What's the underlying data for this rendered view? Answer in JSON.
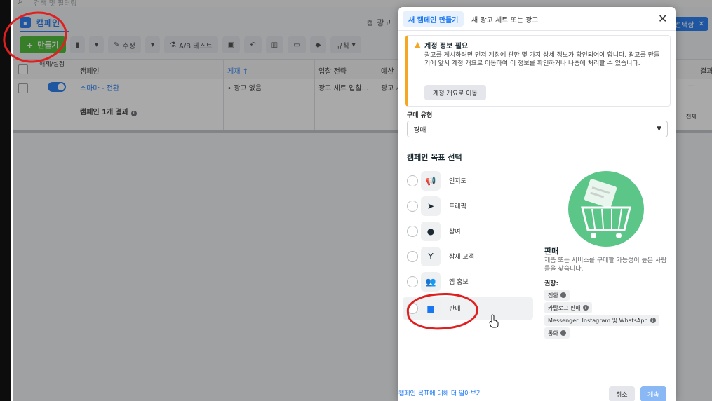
{
  "search": {
    "placeholder": "검색 및 필터링"
  },
  "header": {
    "campaign_tab": "캠페인",
    "adset_tab_prefix": "캠",
    "adset_tab_label": "광고",
    "selected_pill": "선택함"
  },
  "toolbar": {
    "create_label": "만들기",
    "edit_label": "수정",
    "ab_test_label": "A/B 테스트",
    "rules_label": "규칙"
  },
  "table": {
    "headers": [
      "해제/설정",
      "캠페인",
      "게재 ↑",
      "입찰 전략",
      "예산",
      "결과"
    ],
    "rows": [
      {
        "name": "스마마 - 전환",
        "delivery": "• 광고 없음",
        "bid": "광고 세트 입찰...",
        "budget": "광고 세"
      }
    ],
    "summary": "캠페인 1개 결과",
    "tail_dash": "—",
    "tail_total": "전체"
  },
  "modal": {
    "tab_active": "새 캠페인 만들기",
    "tab_other": "새 광고 세트 또는 광고",
    "warning": {
      "title": "계정 정보 필요",
      "body": "광고를 게시하려면 먼저 계정에 관한 몇 가지 상세 정보가 확인되어야 합니다. 광고를 만들기에 앞서 계정 개요로 이동하여 이 정보를 확인하거나 나중에 처리할 수 있습니다.",
      "button": "계정 개요로 이동"
    },
    "buy_type_label": "구매 유형",
    "buy_type_value": "경매",
    "objective_title": "캠페인 목표 선택",
    "objectives": [
      {
        "label": "인지도",
        "icon": "megaphone-icon"
      },
      {
        "label": "트래픽",
        "icon": "cursor-icon"
      },
      {
        "label": "참여",
        "icon": "chat-icon"
      },
      {
        "label": "잠재 고객",
        "icon": "funnel-icon"
      },
      {
        "label": "앱 홍보",
        "icon": "people-icon"
      },
      {
        "label": "판매",
        "icon": "briefcase-icon"
      }
    ],
    "selected_goal": {
      "name": "판매",
      "desc": "제품 또는 서비스를 구매할 가능성이 높은 사람들을 찾습니다.",
      "rec_label": "권장:",
      "recommendations": [
        "전환",
        "카탈로그 판매",
        "Messenger, Instagram 및 WhatsApp",
        "통화"
      ]
    },
    "learn_more": "캠페인 목표에 대해 더 알아보기",
    "cancel": "취소",
    "continue": "계속"
  },
  "colors": {
    "accent": "#1876f2",
    "create_green": "#42b72a",
    "annotation_red": "#e02020",
    "illus_green": "#5cc689"
  }
}
